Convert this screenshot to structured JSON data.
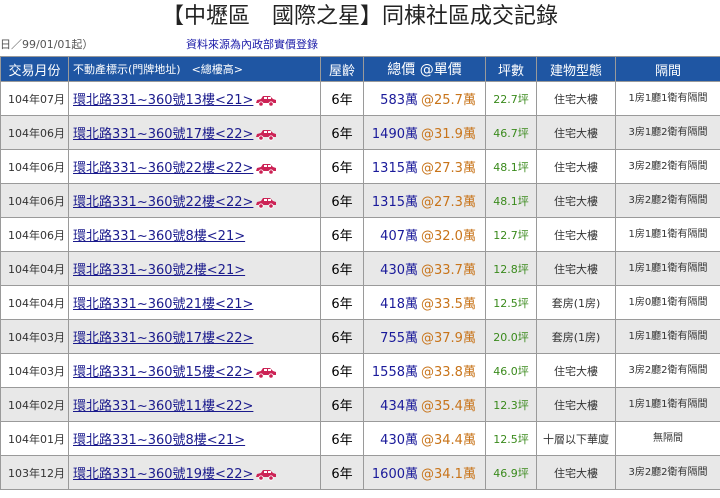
{
  "header": {
    "title": "【中壢區　國際之星】同棟社區成交記錄",
    "range_note": "日／99/01/01起）",
    "source_link": "資料來源為內政部實價登錄"
  },
  "columns": {
    "month": "交易月份",
    "address": "不動產標示(門牌地址)　<總樓高>",
    "age": "屋齡",
    "price": "總價 @單價",
    "ping": "坪數",
    "btype": "建物型態",
    "layout": "隔間"
  },
  "colors": {
    "header_bg": "#1f56a3",
    "total_price": "#1a1a9a",
    "unit_price": "#c8741a",
    "ping": "#3a8a1c",
    "parking_icon": "#cc2255"
  },
  "rows": [
    {
      "month": "104年07月",
      "address": "環北路331~360號13樓<21>",
      "parking": true,
      "age": "6年",
      "total": "583萬",
      "unit": "@25.7萬",
      "ping": "22.7坪",
      "btype": "住宅大樓",
      "layout": "1房1廳1衛有隔間"
    },
    {
      "month": "104年06月",
      "address": "環北路331~360號17樓<22>",
      "parking": true,
      "age": "6年",
      "total": "1490萬",
      "unit": "@31.9萬",
      "ping": "46.7坪",
      "btype": "住宅大樓",
      "layout": "3房1廳2衛有隔間"
    },
    {
      "month": "104年06月",
      "address": "環北路331~360號22樓<22>",
      "parking": true,
      "age": "6年",
      "total": "1315萬",
      "unit": "@27.3萬",
      "ping": "48.1坪",
      "btype": "住宅大樓",
      "layout": "3房2廳2衛有隔間"
    },
    {
      "month": "104年06月",
      "address": "環北路331~360號22樓<22>",
      "parking": true,
      "age": "6年",
      "total": "1315萬",
      "unit": "@27.3萬",
      "ping": "48.1坪",
      "btype": "住宅大樓",
      "layout": "3房2廳2衛有隔間"
    },
    {
      "month": "104年06月",
      "address": "環北路331~360號8樓<21>",
      "parking": false,
      "age": "6年",
      "total": "407萬",
      "unit": "@32.0萬",
      "ping": "12.7坪",
      "btype": "住宅大樓",
      "layout": "1房1廳1衛有隔間"
    },
    {
      "month": "104年04月",
      "address": "環北路331~360號2樓<21>",
      "parking": false,
      "age": "6年",
      "total": "430萬",
      "unit": "@33.7萬",
      "ping": "12.8坪",
      "btype": "住宅大樓",
      "layout": "1房1廳1衛有隔間"
    },
    {
      "month": "104年04月",
      "address": "環北路331~360號21樓<21>",
      "parking": false,
      "age": "6年",
      "total": "418萬",
      "unit": "@33.5萬",
      "ping": "12.5坪",
      "btype": "套房(1房)",
      "layout": "1房0廳1衛有隔間"
    },
    {
      "month": "104年03月",
      "address": "環北路331~360號17樓<22>",
      "parking": false,
      "age": "6年",
      "total": "755萬",
      "unit": "@37.9萬",
      "ping": "20.0坪",
      "btype": "套房(1房)",
      "layout": "1房1廳1衛有隔間"
    },
    {
      "month": "104年03月",
      "address": "環北路331~360號15樓<22>",
      "parking": true,
      "age": "6年",
      "total": "1558萬",
      "unit": "@33.8萬",
      "ping": "46.0坪",
      "btype": "住宅大樓",
      "layout": "3房2廳2衛有隔間"
    },
    {
      "month": "104年02月",
      "address": "環北路331~360號11樓<22>",
      "parking": false,
      "age": "6年",
      "total": "434萬",
      "unit": "@35.4萬",
      "ping": "12.3坪",
      "btype": "住宅大樓",
      "layout": "1房1廳1衛有隔間"
    },
    {
      "month": "104年01月",
      "address": "環北路331~360號8樓<21>",
      "parking": false,
      "age": "6年",
      "total": "430萬",
      "unit": "@34.4萬",
      "ping": "12.5坪",
      "btype": "十層以下華廈",
      "layout": "無隔間"
    },
    {
      "month": "103年12月",
      "address": "環北路331~360號19樓<22>",
      "parking": true,
      "age": "6年",
      "total": "1600萬",
      "unit": "@34.1萬",
      "ping": "46.9坪",
      "btype": "住宅大樓",
      "layout": "3房2廳2衛有隔間"
    }
  ]
}
